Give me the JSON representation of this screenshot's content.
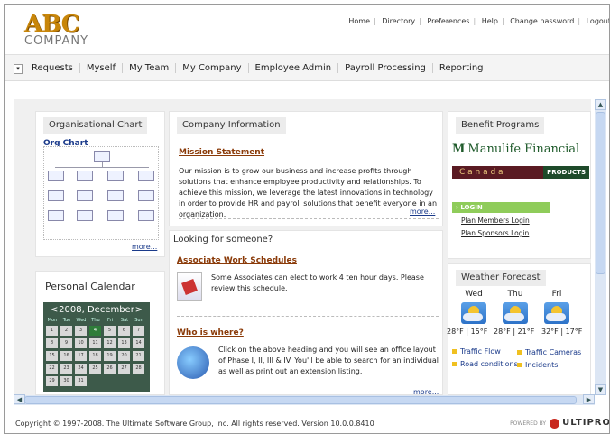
{
  "header": {
    "logo_main": "ABC",
    "logo_sub": "COMPANY",
    "links": [
      "Home",
      "Directory",
      "Preferences",
      "Help",
      "Change password",
      "Logout"
    ]
  },
  "nav": {
    "toggle": "▾",
    "items": [
      "Requests",
      "Myself",
      "My Team",
      "My Company",
      "Employee Admin",
      "Payroll Processing",
      "Reporting"
    ]
  },
  "org_chart": {
    "title": "Organisational Chart",
    "link": "Org Chart",
    "more": "more..."
  },
  "calendar": {
    "title": "Personal Calendar",
    "month_label": "2008, December",
    "prev": "<",
    "next": ">",
    "weekdays": [
      "Mon",
      "Tue",
      "Wed",
      "Thu",
      "Fri",
      "Sat",
      "Sun"
    ],
    "days": [
      "1",
      "2",
      "3",
      "4",
      "5",
      "6",
      "7",
      "8",
      "9",
      "10",
      "11",
      "12",
      "13",
      "14",
      "15",
      "16",
      "17",
      "18",
      "19",
      "20",
      "21",
      "22",
      "23",
      "24",
      "25",
      "26",
      "27",
      "28",
      "29",
      "30",
      "31"
    ],
    "today": "4"
  },
  "company_info": {
    "title": "Company Information",
    "mission_link": "Mission Statement",
    "mission_text": "Our mission is to grow our business and increase profits through solutions that enhance employee productivity and relationships. To achieve this mission, we leverage the latest innovations in technology in order to provide HR and payroll solutions that benefit everyone in an organization.",
    "more": "more..."
  },
  "looking": {
    "title": "Looking for someone?",
    "schedules_link": "Associate Work Schedules",
    "schedules_text": "Some Associates can elect to work 4 ten hour days. Please review this schedule.",
    "where_link": "Who is where?",
    "where_text": "Click on the above heading and you will see an office layout of Phase I, II, III & IV. You'll be able to search for an individual as well as print out an extension listing.",
    "more": "more..."
  },
  "benefits": {
    "title": "Benefit Programs",
    "provider": "Manulife Financial",
    "country": "C a n a d a",
    "products": "PRODUCTS",
    "login": "› LOGIN",
    "links": [
      "Plan Members Login",
      "Plan Sponsors Login"
    ]
  },
  "weather": {
    "title": "Weather Forecast",
    "days": [
      {
        "name": "Wed",
        "temps": "28°F | 15°F"
      },
      {
        "name": "Thu",
        "temps": "28°F | 21°F"
      },
      {
        "name": "Fri",
        "temps": "32°F | 17°F"
      }
    ],
    "links": [
      "Traffic Flow",
      "Traffic Cameras",
      "Road conditions",
      "Incidents"
    ]
  },
  "footer": {
    "copyright": "Copyright © 1997-2008. The Ultimate Software Group, Inc. All rights reserved. Version 10.0.0.8410",
    "powered_by": "POWERED BY",
    "brand": "ULTIPRO"
  },
  "colors": {
    "link": "#8a3a08",
    "calendar_bg": "#3d5a4a",
    "manulife_green": "#1e5a2a",
    "canada_bar": "#5a1a22"
  }
}
